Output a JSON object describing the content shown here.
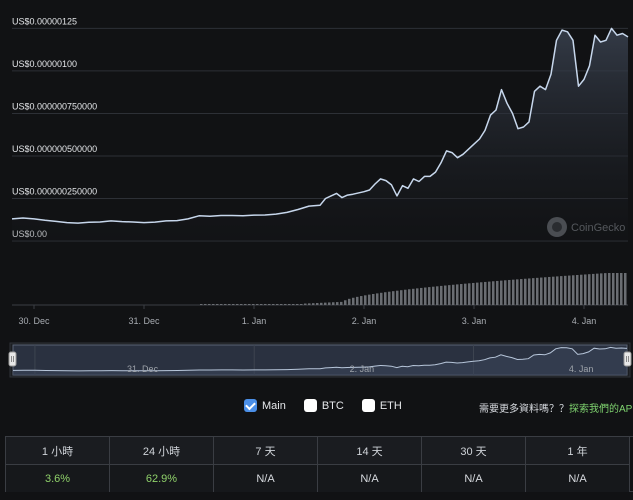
{
  "chart_data": {
    "type": "area",
    "ylabels": [
      "US$0.00000125",
      "US$0.00000100",
      "US$0.000000750000",
      "US$0.000000500000",
      "US$0.000000250000",
      "US$0.00"
    ],
    "y_ticks": [
      1.25e-06,
      1e-06,
      7.5e-07,
      5e-07,
      2.5e-07,
      0
    ],
    "ylim": [
      0,
      1.27e-06
    ],
    "x_ticks": [
      "30. Dec",
      "31. Dec",
      "1. Jan",
      "2. Jan",
      "3. Jan",
      "4. Jan"
    ],
    "x_range": [
      0,
      5.6
    ],
    "x_tick_positions": [
      0.2,
      1.2,
      2.2,
      3.2,
      4.2,
      5.2
    ],
    "grid": true,
    "series": [
      {
        "values": [
          [
            0.0,
            1.3e-07
          ],
          [
            0.1,
            1.35e-07
          ],
          [
            0.2,
            1.3e-07
          ],
          [
            0.3,
            1.22e-07
          ],
          [
            0.4,
            1.15e-07
          ],
          [
            0.5,
            1.08e-07
          ],
          [
            0.6,
            1.05e-07
          ],
          [
            0.7,
            1.1e-07
          ],
          [
            0.8,
            1.12e-07
          ],
          [
            0.9,
            1.18e-07
          ],
          [
            1.0,
            1.14e-07
          ],
          [
            1.1,
            1.12e-07
          ],
          [
            1.2,
            1.08e-07
          ],
          [
            1.3,
            1.11e-07
          ],
          [
            1.4,
            1.18e-07
          ],
          [
            1.5,
            1.2e-07
          ],
          [
            1.6,
            1.3e-07
          ],
          [
            1.7,
            1.48e-07
          ],
          [
            1.8,
            1.45e-07
          ],
          [
            1.9,
            1.5e-07
          ],
          [
            2.0,
            1.5e-07
          ],
          [
            2.1,
            1.48e-07
          ],
          [
            2.2,
            1.52e-07
          ],
          [
            2.3,
            1.53e-07
          ],
          [
            2.4,
            1.58e-07
          ],
          [
            2.5,
            1.68e-07
          ],
          [
            2.6,
            1.85e-07
          ],
          [
            2.7,
            2.05e-07
          ],
          [
            2.8,
            2.1e-07
          ],
          [
            2.85,
            2.5e-07
          ],
          [
            2.9,
            2.65e-07
          ],
          [
            2.95,
            2.8e-07
          ],
          [
            3.0,
            2.55e-07
          ],
          [
            3.05,
            2.7e-07
          ],
          [
            3.1,
            2.75e-07
          ],
          [
            3.2,
            2.9e-07
          ],
          [
            3.25,
            3e-07
          ],
          [
            3.3,
            3.35e-07
          ],
          [
            3.35,
            3.65e-07
          ],
          [
            3.4,
            3.55e-07
          ],
          [
            3.45,
            3.3e-07
          ],
          [
            3.5,
            2.65e-07
          ],
          [
            3.55,
            3.25e-07
          ],
          [
            3.6,
            3.1e-07
          ],
          [
            3.65,
            3.65e-07
          ],
          [
            3.7,
            3.5e-07
          ],
          [
            3.75,
            3.8e-07
          ],
          [
            3.8,
            3.8e-07
          ],
          [
            3.85,
            4.05e-07
          ],
          [
            3.9,
            4.6e-07
          ],
          [
            3.95,
            5.3e-07
          ],
          [
            4.0,
            5.2e-07
          ],
          [
            4.05,
            4.9e-07
          ],
          [
            4.1,
            5.1e-07
          ],
          [
            4.15,
            5.4e-07
          ],
          [
            4.2,
            5.7e-07
          ],
          [
            4.25,
            6e-07
          ],
          [
            4.3,
            6.5e-07
          ],
          [
            4.35,
            7.4e-07
          ],
          [
            4.4,
            7.7e-07
          ],
          [
            4.45,
            8.9e-07
          ],
          [
            4.5,
            8.1e-07
          ],
          [
            4.55,
            7.5e-07
          ],
          [
            4.6,
            6.6e-07
          ],
          [
            4.65,
            6.7e-07
          ],
          [
            4.7,
            7e-07
          ],
          [
            4.75,
            8.8e-07
          ],
          [
            4.8,
            9.1e-07
          ],
          [
            4.85,
            8.9e-07
          ],
          [
            4.9,
            9.8e-07
          ],
          [
            4.95,
            1.18e-06
          ],
          [
            5.0,
            1.24e-06
          ],
          [
            5.05,
            1.23e-06
          ],
          [
            5.1,
            1.18e-06
          ],
          [
            5.15,
            9.1e-07
          ],
          [
            5.2,
            9.5e-07
          ],
          [
            5.25,
            1.03e-06
          ],
          [
            5.3,
            1.21e-06
          ],
          [
            5.35,
            1.17e-06
          ],
          [
            5.4,
            1.18e-06
          ],
          [
            5.45,
            1.25e-06
          ],
          [
            5.5,
            1.21e-06
          ],
          [
            5.55,
            1.22e-06
          ],
          [
            5.6,
            1.2e-06
          ]
        ]
      }
    ],
    "volume": {
      "x_start": 3.0,
      "x_end": 5.6,
      "start_fraction": 0.1,
      "end_fraction": 1.0
    },
    "navigator": {
      "x_ticks": [
        "31. Dec",
        "2. Jan",
        "4. Jan"
      ],
      "x_tick_positions": [
        1.2,
        3.2,
        5.2
      ]
    },
    "watermark": "CoinGecko"
  },
  "legend": [
    {
      "label": "Main",
      "checked": true
    },
    {
      "label": "BTC",
      "checked": false
    },
    {
      "label": "ETH",
      "checked": false
    }
  ],
  "promo": {
    "question": "需要更多資料嗎？？",
    "link": "探索我們的API"
  },
  "performance": {
    "headers": [
      "1 小時",
      "24 小時",
      "7 天",
      "14 天",
      "30 天",
      "1 年"
    ],
    "values": [
      "3.6%",
      "62.9%",
      "N/A",
      "N/A",
      "N/A",
      "N/A"
    ],
    "positive": [
      true,
      true,
      false,
      false,
      false,
      false
    ]
  },
  "colors": {
    "line": "#c7d7ec",
    "area_top": "#3a4250",
    "area_bottom": "#15171b",
    "grid": "#2d3036",
    "volume": "#6a6d72",
    "positive": "#8fd16a"
  }
}
